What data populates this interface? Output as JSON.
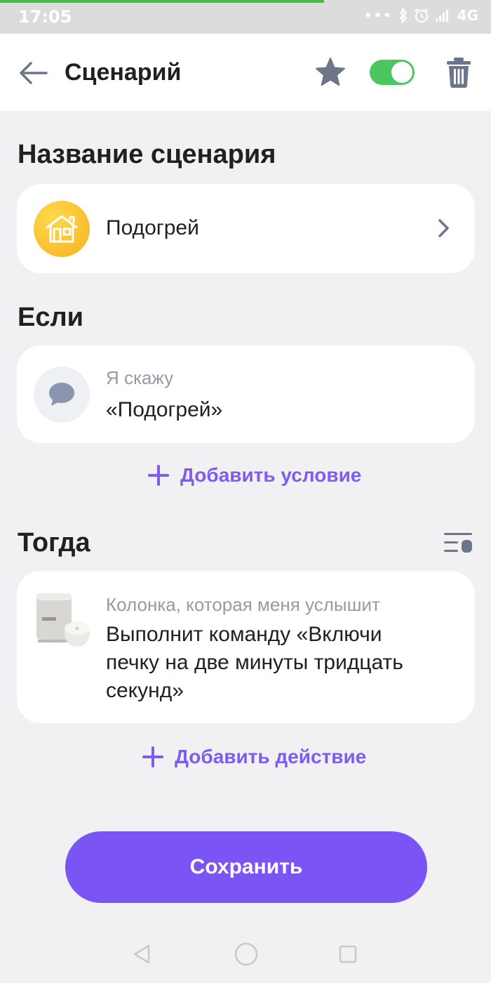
{
  "status_bar": {
    "time": "17:05",
    "network": "4G"
  },
  "app_bar": {
    "title": "Сценарий",
    "toggle_on": true,
    "accent_color": "#4cc760"
  },
  "name_section": {
    "title": "Название сценария",
    "scenario_name": "Подогрей",
    "icon": "house-icon"
  },
  "if_section": {
    "title": "Если",
    "condition_label": "Я скажу",
    "condition_value": "«Подогрей»",
    "add_condition_label": "Добавить условие"
  },
  "then_section": {
    "title": "Тогда",
    "action_device": "Колонка, которая меня услышит",
    "action_lines": [
      "Выполнит команду «Включи",
      "печку на две минуты тридцать",
      "секунд»"
    ],
    "add_action_label": "Добавить действие"
  },
  "save_label": "Сохранить",
  "colors": {
    "primary": "#7b54f5",
    "link": "#7f5cf0",
    "background": "#f1f1f4"
  }
}
